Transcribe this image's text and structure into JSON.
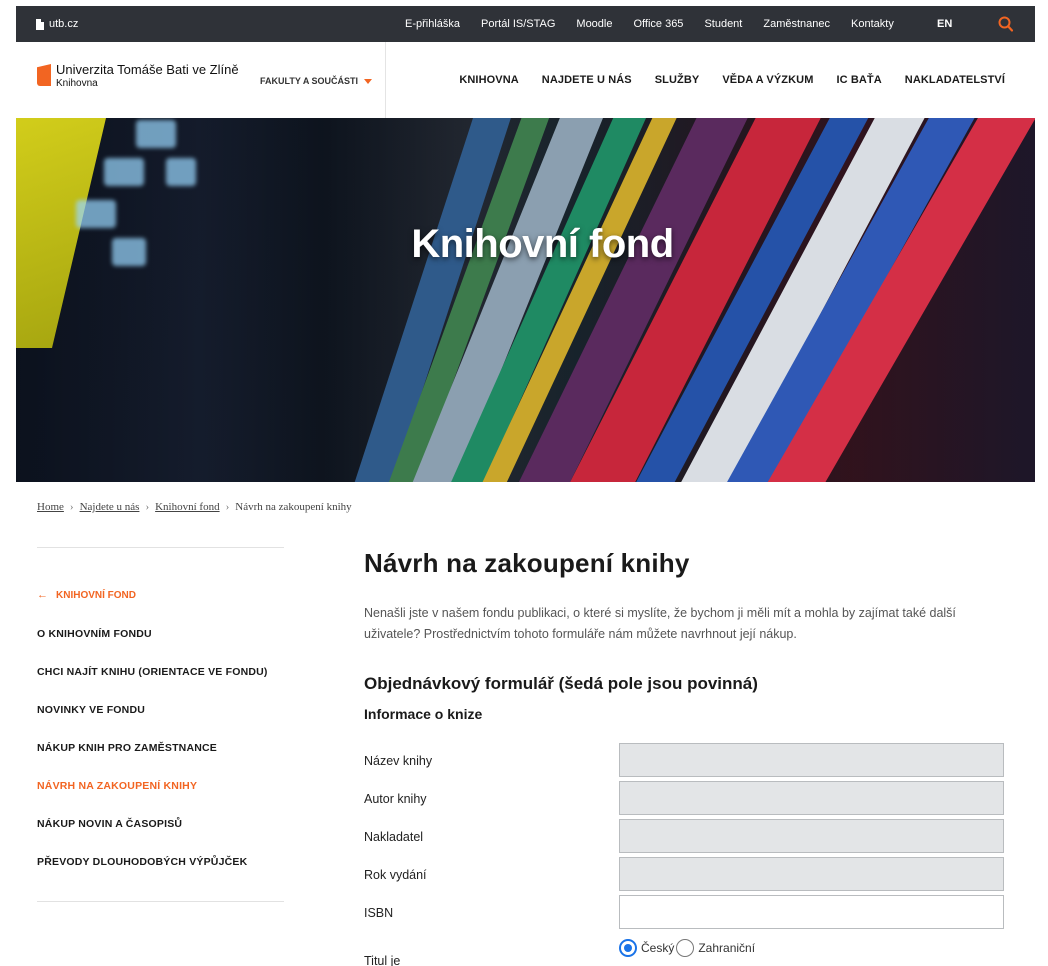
{
  "topbar": {
    "site": "utb.cz",
    "links": [
      "E-přihláška",
      "Portál IS/STAG",
      "Moodle",
      "Office 365",
      "Student",
      "Zaměstnanec",
      "Kontakty"
    ],
    "lang": "EN",
    "search_icon": "search-icon"
  },
  "header": {
    "university": "Univerzita Tomáše Bati ve Zlíně",
    "unit": "Knihovna",
    "faculties": "FAKULTY A SOUČÁSTI",
    "nav": [
      "KNIHOVNA",
      "NAJDETE U NÁS",
      "SLUŽBY",
      "VĚDA A VÝZKUM",
      "IC BAŤA",
      "NAKLADATELSTVÍ"
    ]
  },
  "hero": {
    "title": "Knihovní fond"
  },
  "breadcrumb": [
    "Home",
    "Najdete u nás",
    "Knihovní fond",
    "Návrh na zakoupení knihy"
  ],
  "sidebar": {
    "back": "KNIHOVNÍ FOND",
    "items": [
      {
        "label": "O KNIHOVNÍM FONDU",
        "active": false
      },
      {
        "label": "CHCI NAJÍT KNIHU (ORIENTACE VE FONDU)",
        "active": false
      },
      {
        "label": "NOVINKY VE FONDU",
        "active": false
      },
      {
        "label": "NÁKUP KNIH PRO ZAMĚSTNANCE",
        "active": false
      },
      {
        "label": "NÁVRH NA ZAKOUPENÍ KNIHY",
        "active": true
      },
      {
        "label": "NÁKUP NOVIN A ČASOPISŮ",
        "active": false
      },
      {
        "label": "PŘEVODY DLOUHODOBÝCH VÝPŮJČEK",
        "active": false
      }
    ]
  },
  "main": {
    "title": "Návrh na zakoupení knihy",
    "intro": "Nenašli jste v našem fondu publikaci, o které si myslíte, že bychom ji měli mít a mohla by zajímat také další uživatele? Prostřednictvím tohoto formuláře nám můžete navrhnout její nákup.",
    "form_title": "Objednávkový formulář (šedá pole jsou povinná)",
    "section_title": "Informace o knize"
  },
  "form": {
    "fields": [
      {
        "label": "Název knihy",
        "value": "",
        "required": true
      },
      {
        "label": "Autor knihy",
        "value": "",
        "required": true
      },
      {
        "label": "Nakladatel",
        "value": "",
        "required": true
      },
      {
        "label": "Rok vydání",
        "value": "",
        "required": true
      },
      {
        "label": "ISBN",
        "value": "",
        "required": false
      }
    ],
    "title_type": {
      "label": "Titul je",
      "options": [
        "Český",
        "Zahraniční"
      ],
      "selected": "Český"
    }
  },
  "colors": {
    "accent": "#f26522",
    "topbar": "#2f3238",
    "required_field": "#e3e5e7",
    "radio": "#1a73e8"
  }
}
